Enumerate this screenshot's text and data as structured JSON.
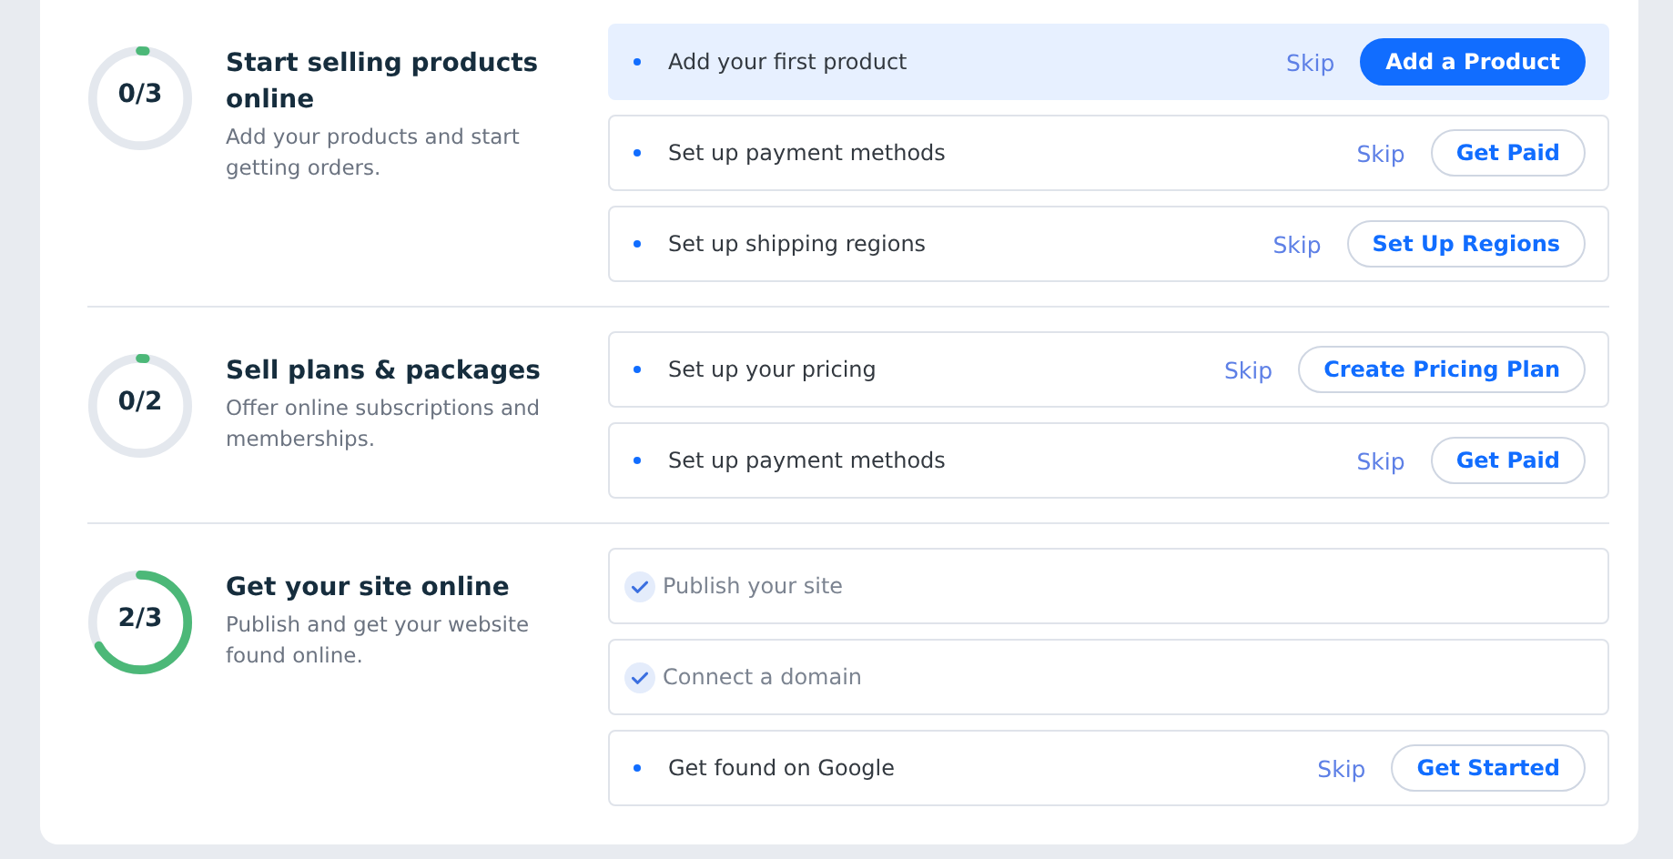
{
  "sections": [
    {
      "progress": "0/3",
      "level": 0,
      "title": "Start selling products online",
      "description": "Add your products and start getting orders.",
      "tasks": [
        {
          "label": "Add your first product",
          "done": false,
          "highlighted": true,
          "skip": "Skip",
          "action": {
            "label": "Add a Product",
            "kind": "primary"
          }
        },
        {
          "label": "Set up payment methods",
          "done": false,
          "highlighted": false,
          "skip": "Skip",
          "action": {
            "label": "Get Paid",
            "kind": "secondary"
          }
        },
        {
          "label": "Set up shipping regions",
          "done": false,
          "highlighted": false,
          "skip": "Skip",
          "action": {
            "label": "Set Up Regions",
            "kind": "secondary"
          }
        }
      ]
    },
    {
      "progress": "0/2",
      "level": 0,
      "title": "Sell plans & packages",
      "description": "Offer online subscriptions and memberships.",
      "tasks": [
        {
          "label": "Set up your pricing",
          "done": false,
          "highlighted": false,
          "skip": "Skip",
          "action": {
            "label": "Create Pricing Plan",
            "kind": "secondary"
          }
        },
        {
          "label": "Set up payment methods",
          "done": false,
          "highlighted": false,
          "skip": "Skip",
          "action": {
            "label": "Get Paid",
            "kind": "secondary"
          }
        }
      ]
    },
    {
      "progress": "2/3",
      "level": 0.667,
      "title": "Get your site online",
      "description": "Publish and get your website found online.",
      "tasks": [
        {
          "label": "Publish your site",
          "done": true,
          "highlighted": false
        },
        {
          "label": "Connect a domain",
          "done": true,
          "highlighted": false
        },
        {
          "label": "Get found on Google",
          "done": false,
          "highlighted": false,
          "skip": "Skip",
          "action": {
            "label": "Get Started",
            "kind": "secondary"
          }
        }
      ]
    }
  ]
}
